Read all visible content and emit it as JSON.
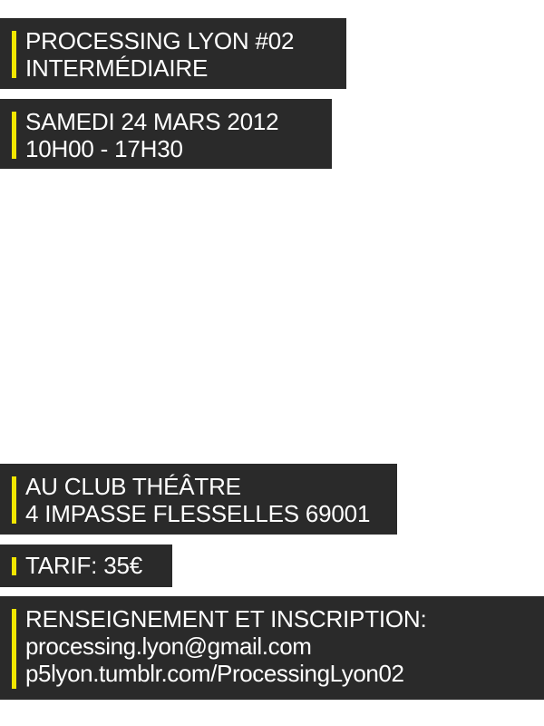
{
  "event": {
    "title_line1": "PROCESSING LYON #02",
    "title_line2": "INTERMÉDIAIRE"
  },
  "schedule": {
    "date": "SAMEDI 24 MARS 2012",
    "time": "10H00 - 17H30"
  },
  "venue": {
    "name": "AU CLUB THÉÂTRE",
    "address": "4 IMPASSE FLESSELLES 69001"
  },
  "price": {
    "label": "TARIF: 35€"
  },
  "contact": {
    "heading": "RENSEIGNEMENT ET INSCRIPTION:",
    "email": "processing.lyon@gmail.com",
    "url": "p5lyon.tumblr.com/ProcessingLyon02"
  },
  "colors": {
    "block_background": "#2a2a2a",
    "accent_bar": "#f2e600",
    "text": "#ffffff",
    "page_background": "#ffffff"
  }
}
